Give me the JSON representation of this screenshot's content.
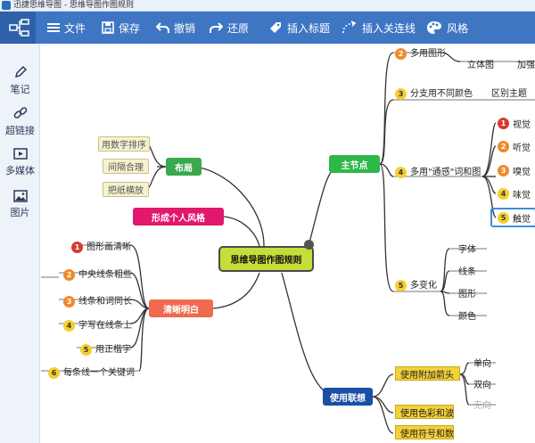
{
  "window": {
    "title": "迅捷思维导图 - 思维导图作图规则"
  },
  "toolbar": {
    "file": "文件",
    "save": "保存",
    "undo": "撤销",
    "redo": "还原",
    "insert_topic": "插入标题",
    "insert_relation": "插入关连线",
    "style": "风格"
  },
  "sidebar": {
    "notes": "笔记",
    "hyperlink": "超链接",
    "multimedia": "多媒体",
    "image": "图片"
  },
  "mindmap": {
    "center": "思维导图作图规则",
    "layout": {
      "label": "布局",
      "color": "#3aa84d",
      "items": [
        "用数字排序",
        "间隔合理",
        "把纸横放"
      ]
    },
    "personal_style": {
      "label": "形成个人风格",
      "color": "#e2186d"
    },
    "clear": {
      "label": "清晰明白",
      "color": "#ef6a4f",
      "items": [
        {
          "num": "1",
          "text": "图形画清晰"
        },
        {
          "num": "2",
          "text": "中央线条粗些"
        },
        {
          "num": "3",
          "text": "线条和词同长"
        },
        {
          "num": "4",
          "text": "字写在线条上"
        },
        {
          "num": "5",
          "text": "用正楷字"
        },
        {
          "num": "6",
          "text": "每条线一个关键词"
        }
      ]
    },
    "main_point": {
      "label": "主节点",
      "color": "#2db84a",
      "items": [
        {
          "num": "2",
          "text": "多用图形"
        },
        {
          "num": "3",
          "text": "分支用不同颜色"
        },
        {
          "num": "4",
          "text": "多用\"通感\"词和图"
        },
        {
          "num": "5",
          "text": "多变化"
        }
      ],
      "graphics_sub": [
        "立体图",
        "加强"
      ],
      "color_sub": "区别主题",
      "senses": [
        {
          "num": "1",
          "text": "视觉"
        },
        {
          "num": "2",
          "text": "听觉"
        },
        {
          "num": "3",
          "text": "嗅觉"
        },
        {
          "num": "4",
          "text": "味觉"
        },
        {
          "num": "5",
          "text": "触觉"
        }
      ],
      "variations": [
        "字体",
        "线条",
        "图形",
        "颜色"
      ]
    },
    "association": {
      "label": "使用联想",
      "color": "#1a4fa6",
      "items": [
        "使用附加箭头",
        "使用色彩和波",
        "使用符号和数"
      ],
      "arrow_sub": [
        "单向",
        "双向",
        "无向"
      ]
    }
  },
  "colors": {
    "toolbar": "#3e76c4",
    "sidebar": "#eef2f9",
    "center_node": "#c6dd3a"
  }
}
